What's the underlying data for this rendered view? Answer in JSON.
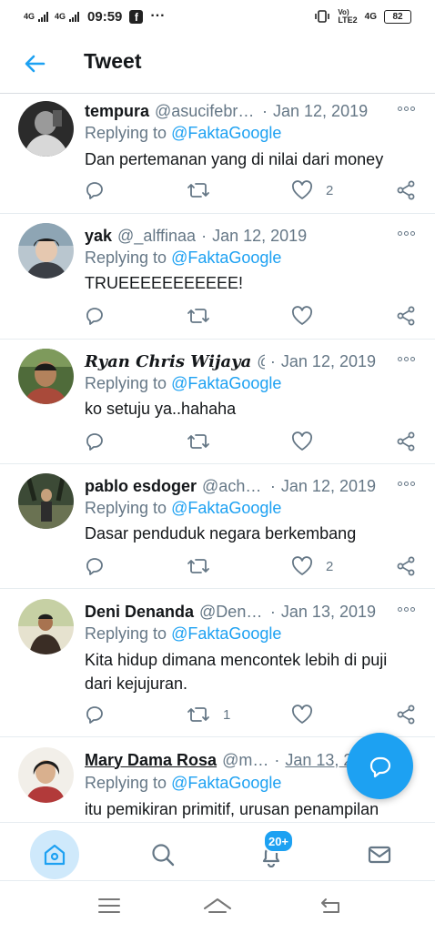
{
  "status_bar": {
    "sig1": "4G",
    "sig2": "4G",
    "time": "09:59",
    "lte_label": "LTE2",
    "net_label": "4G",
    "battery": "82",
    "icons": [
      "signal-icon",
      "facebook-icon",
      "more-dots-icon",
      "vibrate-icon",
      "volte-icon",
      "battery-icon"
    ]
  },
  "header": {
    "title": "Tweet",
    "back_icon": "arrow-left-icon"
  },
  "colors": {
    "accent": "#1da1f2",
    "muted": "#657786",
    "text": "#14171a",
    "home_bg": "#cfe9fb"
  },
  "tweets": [
    {
      "name": "tempura",
      "handle": "@asucifebri…",
      "date": "Jan 12, 2019",
      "replying_prefix": "Replying to",
      "mention": "@FaktaGoogle",
      "text": "Dan pertemanan yang di nilai dari money",
      "retweets": "",
      "likes": "2"
    },
    {
      "name": "yak",
      "handle": "@_alffinaa",
      "date": "Jan 12, 2019",
      "replying_prefix": "Replying to",
      "mention": "@FaktaGoogle",
      "text": "TRUEEEEEEEEEEE!",
      "retweets": "",
      "likes": ""
    },
    {
      "name": "Ryan Chris Wijaya",
      "handle": "@R…",
      "date": "Jan 12, 2019",
      "replying_prefix": "Replying to",
      "mention": "@FaktaGoogle",
      "text": "ko setuju ya..hahaha",
      "retweets": "",
      "likes": ""
    },
    {
      "name": "pablo esdoger",
      "handle": "@achi…",
      "date": "Jan 12, 2019",
      "replying_prefix": "Replying to",
      "mention": "@FaktaGoogle",
      "text": "Dasar penduduk negara berkembang",
      "retweets": "",
      "likes": "2"
    },
    {
      "name": "Deni Denanda",
      "handle": "@Deni…",
      "date": "Jan 13, 2019",
      "replying_prefix": "Replying to",
      "mention": "@FaktaGoogle",
      "text": "Kita hidup dimana mencontek lebih di puji dari kejujuran.",
      "retweets": "1",
      "likes": ""
    },
    {
      "name": "Mary Dama Rosa",
      "handle": "@m…",
      "date": "Jan 13, 20",
      "replying_prefix": "Replying to",
      "mention": "@FaktaGoogle",
      "text": "itu pemikiran primitif, urusan penampilan",
      "retweets": "",
      "likes": ""
    }
  ],
  "fab": {
    "icon": "compose-reply-icon"
  },
  "bottom_nav": {
    "items": [
      "home-icon",
      "search-icon",
      "notifications-icon",
      "messages-icon"
    ],
    "notif_badge": "20+"
  },
  "system_nav": {
    "items": [
      "menu-icon",
      "home-chevron-icon",
      "back-icon"
    ]
  }
}
